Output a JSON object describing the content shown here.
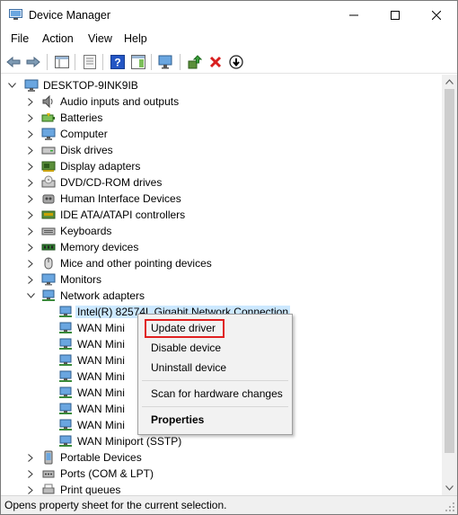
{
  "window": {
    "title": "Device Manager",
    "minimize_glyph": "—",
    "maximize_glyph": "☐",
    "close_glyph": "✕"
  },
  "menu": [
    "File",
    "Action",
    "View",
    "Help"
  ],
  "toolbar_icons": [
    "back-arrow-icon",
    "forward-arrow-icon",
    "show-hide-console-tree-icon",
    "properties-icon",
    "help-icon",
    "action-pane-icon",
    "monitor-scan-icon",
    "update-driver-icon",
    "uninstall-x-icon",
    "disable-device-icon"
  ],
  "tree": {
    "root": "DESKTOP-9INK9IB",
    "categories": [
      "Audio inputs and outputs",
      "Batteries",
      "Computer",
      "Disk drives",
      "Display adapters",
      "DVD/CD-ROM drives",
      "Human Interface Devices",
      "IDE ATA/ATAPI controllers",
      "Keyboards",
      "Memory devices",
      "Mice and other pointing devices",
      "Monitors",
      "Network adapters"
    ],
    "network_children": [
      "Intel(R) 82574L Gigabit Network Connection",
      "WAN Mini",
      "WAN Mini",
      "WAN Mini",
      "WAN Mini",
      "WAN Mini",
      "WAN Mini",
      "WAN Mini",
      "WAN Miniport (SSTP)"
    ],
    "after_categories": [
      "Portable Devices",
      "Ports (COM & LPT)",
      "Print queues"
    ]
  },
  "context_menu": {
    "update_driver": "Update driver",
    "disable_device": "Disable device",
    "uninstall_device": "Uninstall device",
    "scan": "Scan for hardware changes",
    "properties": "Properties"
  },
  "status": "Opens property sheet for the current selection.",
  "colors": {
    "selection": "#cce8ff",
    "highlight_border": "#e02020",
    "menu_bg": "#f2f2f2"
  }
}
